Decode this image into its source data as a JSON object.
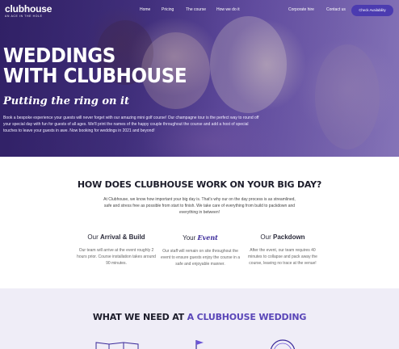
{
  "nav": {
    "logo": "clubhouse",
    "logo_tagline": "AN ACE IN THE HOLE",
    "links": [
      "Home",
      "Pricing",
      "The course",
      "How we do it"
    ],
    "corporate": "Corporate hire",
    "contact": "Contact us",
    "cta": "Check Availability"
  },
  "hero": {
    "title_line1": "WEDDINGS",
    "title_line2": "WITH CLUBHOUSE",
    "script": "Putting the ring on it",
    "text": "Book a bespoke experience your guests will never forget with our amazing mini golf course! Our champagne tour is the perfect way to round off your special day with fun for guests of all ages. We'll print the names of the happy couple throughout the course and add a host of special touches to leave your guests in awe. Now booking for weddings in 2021 and beyond!"
  },
  "how": {
    "title": "HOW DOES CLUBHOUSE WORK ON YOUR BIG DAY?",
    "text": "At Clubhouse, we know how important your big day is. That's why our on the day process is as streamlined, safe and stress free as possible from start to finish. We take care of everything from build to packdown and everything in between!",
    "steps": [
      {
        "prefix": "Our",
        "highlight": "Arrival & Build",
        "desc": "Our team will arrive at the event roughly 2 hours prior. Course installation takes around 90 minutes."
      },
      {
        "prefix": "Your",
        "highlight": "Event",
        "desc": "Our staff will remain on site throughout the event to ensure guests enjoy the course in a safe and enjoyable manner."
      },
      {
        "prefix": "Our",
        "highlight": "Packdown",
        "desc": "After the event, our team requires 40 minutes to collapse and pack away the course, leaving no trace at the venue!"
      }
    ]
  },
  "need": {
    "title_prefix": "WHAT WE NEED AT",
    "title_accent": "A CLUBHOUSE WEDDING"
  },
  "icons": [
    "map-icon",
    "flag-icon",
    "badge-icon"
  ],
  "colors": {
    "accent": "#4b3bb0",
    "accent_text": "#5a46b8",
    "section_bg": "#efedf7"
  }
}
